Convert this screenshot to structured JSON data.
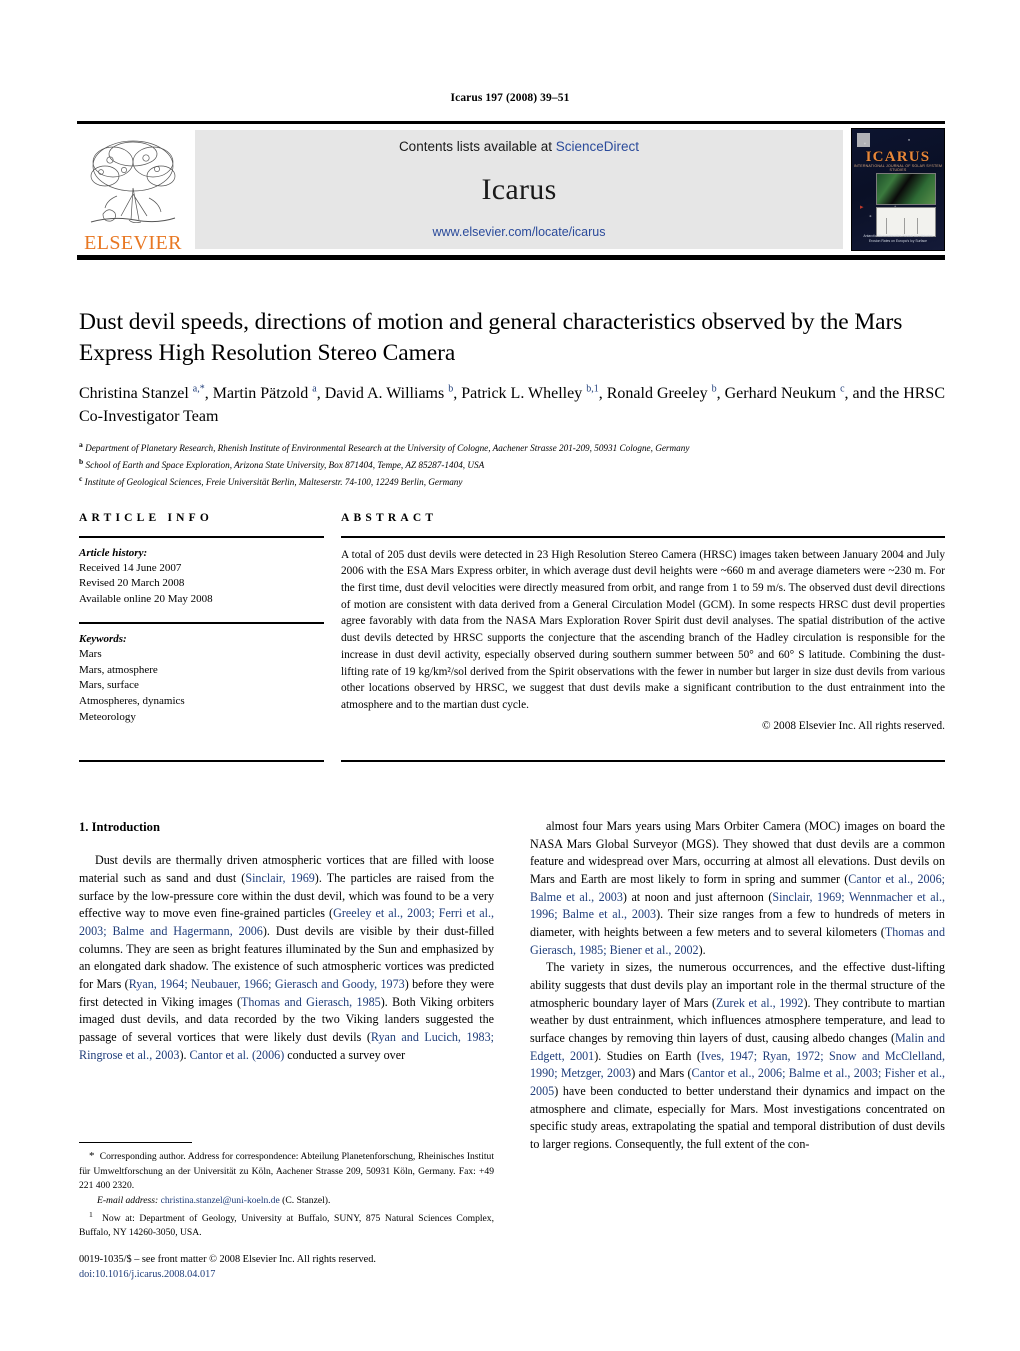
{
  "running_head": "Icarus 197 (2008) 39–51",
  "journal_header": {
    "contents_prefix": "Contents lists available at ",
    "sciencedirect": "ScienceDirect",
    "journal_name": "Icarus",
    "journal_url": "www.elsevier.com/locate/icarus",
    "publisher_word": "ELSEVIER",
    "cover": {
      "title": "ICARUS",
      "subtitle": "INTERNATIONAL JOURNAL OF SOLAR SYSTEM STUDIES",
      "caption_line1": "Antarctic Micrometeorites Reveal Ice Histories",
      "caption_line2": "Erosion Rates on Europa's Icy Surface"
    },
    "accent_orange": "#E87722",
    "link_blue": "#2b4b9b",
    "panel_gray": "#e6e6e6"
  },
  "title": "Dust devil speeds, directions of motion and general characteristics observed by the Mars Express High Resolution Stereo Camera",
  "authors_html": "Christina Stanzel <sup>a,*</sup>, Martin Pätzold <sup>a</sup>, David A. Williams <sup>b</sup>, Patrick L. Whelley <sup>b,1</sup>, Ronald Greeley <sup>b</sup>, Gerhard Neukum <sup>c</sup>, and the HRSC Co-Investigator Team",
  "affiliations": [
    {
      "mark": "a",
      "text": "Department of Planetary Research, Rhenish Institute of Environmental Research at the University of Cologne, Aachener Strasse 201-209, 50931 Cologne, Germany"
    },
    {
      "mark": "b",
      "text": "School of Earth and Space Exploration, Arizona State University, Box 871404, Tempe, AZ 85287-1404, USA"
    },
    {
      "mark": "c",
      "text": "Institute of Geological Sciences, Freie Universität Berlin, Malteserstr. 74-100, 12249 Berlin, Germany"
    }
  ],
  "article_info": {
    "heading": "ARTICLE INFO",
    "history_label": "Article history:",
    "history": [
      "Received 14 June 2007",
      "Revised 20 March 2008",
      "Available online 20 May 2008"
    ],
    "keywords_label": "Keywords:",
    "keywords": [
      "Mars",
      "Mars, atmosphere",
      "Mars, surface",
      "Atmospheres, dynamics",
      "Meteorology"
    ]
  },
  "abstract": {
    "heading": "ABSTRACT",
    "body": "A total of 205 dust devils were detected in 23 High Resolution Stereo Camera (HRSC) images taken between January 2004 and July 2006 with the ESA Mars Express orbiter, in which average dust devil heights were ~660 m and average diameters were ~230 m. For the first time, dust devil velocities were directly measured from orbit, and range from 1 to 59 m/s. The observed dust devil directions of motion are consistent with data derived from a General Circulation Model (GCM). In some respects HRSC dust devil properties agree favorably with data from the NASA Mars Exploration Rover Spirit dust devil analyses. The spatial distribution of the active dust devils detected by HRSC supports the conjecture that the ascending branch of the Hadley circulation is responsible for the increase in dust devil activity, especially observed during southern summer between 50° and 60° S latitude. Combining the dust-lifting rate of 19 kg/km²/sol derived from the Spirit observations with the fewer in number but larger in size dust devils from various other locations observed by HRSC, we suggest that dust devils make a significant contribution to the dust entrainment into the atmosphere and to the martian dust cycle.",
    "copyright": "© 2008 Elsevier Inc. All rights reserved."
  },
  "body": {
    "section_title": "1. Introduction",
    "left_paragraph_html": "Dust devils are thermally driven atmospheric vortices that are filled with loose material such as sand and dust (<span class=\"ref\">Sinclair, 1969</span>). The particles are raised from the surface by the low-pressure core within the dust devil, which was found to be a very effective way to move even fine-grained particles (<span class=\"ref\">Greeley et al., 2003; Ferri et al., 2003; Balme and Hagermann, 2006</span>). Dust devils are visible by their dust-filled columns. They are seen as bright features illuminated by the Sun and emphasized by an elongated dark shadow. The existence of such atmospheric vortices was predicted for Mars (<span class=\"ref\">Ryan, 1964; Neubauer, 1966; Gierasch and Goody, 1973</span>) before they were first detected in Viking images (<span class=\"ref\">Thomas and Gierasch, 1985</span>). Both Viking orbiters imaged dust devils, and data recorded by the two Viking landers suggested the passage of several vortices that were likely dust devils (<span class=\"ref\">Ryan and Lucich, 1983; Ringrose et al., 2003</span>). <span class=\"ref\">Cantor et al. (2006)</span> conducted a survey over",
    "right_paragraph1_html": "almost four Mars years using Mars Orbiter Camera (MOC) images on board the NASA Mars Global Surveyor (MGS). They showed that dust devils are a common feature and widespread over Mars, occurring at almost all elevations. Dust devils on Mars and Earth are most likely to form in spring and summer (<span class=\"ref\">Cantor et al., 2006; Balme et al., 2003</span>) at noon and just afternoon (<span class=\"ref\">Sinclair, 1969; Wennmacher et al., 1996; Balme et al., 2003</span>). Their size ranges from a few to hundreds of meters in diameter, with heights between a few meters and to several kilometers (<span class=\"ref\">Thomas and Gierasch, 1985; Biener et al., 2002</span>).",
    "right_paragraph2_html": "The variety in sizes, the numerous occurrences, and the effective dust-lifting ability suggests that dust devils play an important role in the thermal structure of the atmospheric boundary layer of Mars (<span class=\"ref\">Zurek et al., 1992</span>). They contribute to martian weather by dust entrainment, which influences atmosphere temperature, and lead to surface changes by removing thin layers of dust, causing albedo changes (<span class=\"ref\">Malin and Edgett, 2001</span>). Studies on Earth (<span class=\"ref\">Ives, 1947; Ryan, 1972; Snow and McClelland, 1990; Metzger, 2003</span>) and Mars (<span class=\"ref\">Cantor et al., 2006; Balme et al., 2003; Fisher et al., 2005</span>) have been conducted to better understand their dynamics and impact on the atmosphere and climate, especially for Mars. Most investigations concentrated on specific study areas, extrapolating the spatial and temporal distribution of dust devils to larger regions. Consequently, the full extent of the con-"
  },
  "footnotes": {
    "corresponding_html": "<span class=\"star-mark\">*</span>&nbsp; Corresponding author. Address for correspondence: Abteilung Planetenforschung, Rheinisches Institut für Umweltforschung an der Universität zu Köln, Aachener Strasse 209, 50931 Köln, Germany. Fax: +49 221 400 2320.",
    "email_html": "<span class=\"it\">E-mail address:</span> <span class=\"link\">christina.stanzel@uni-koeln.de</span> (C. Stanzel).",
    "note1_html": "<span class=\"mark\">1</span>&nbsp; Now at: Department of Geology, University at Buffalo, SUNY, 875 Natural Sciences Complex, Buffalo, NY 14260-3050, USA."
  },
  "imprint": {
    "line1": "0019-1035/$ – see front matter © 2008 Elsevier Inc. All rights reserved.",
    "doi": "doi:10.1016/j.icarus.2008.04.017"
  }
}
